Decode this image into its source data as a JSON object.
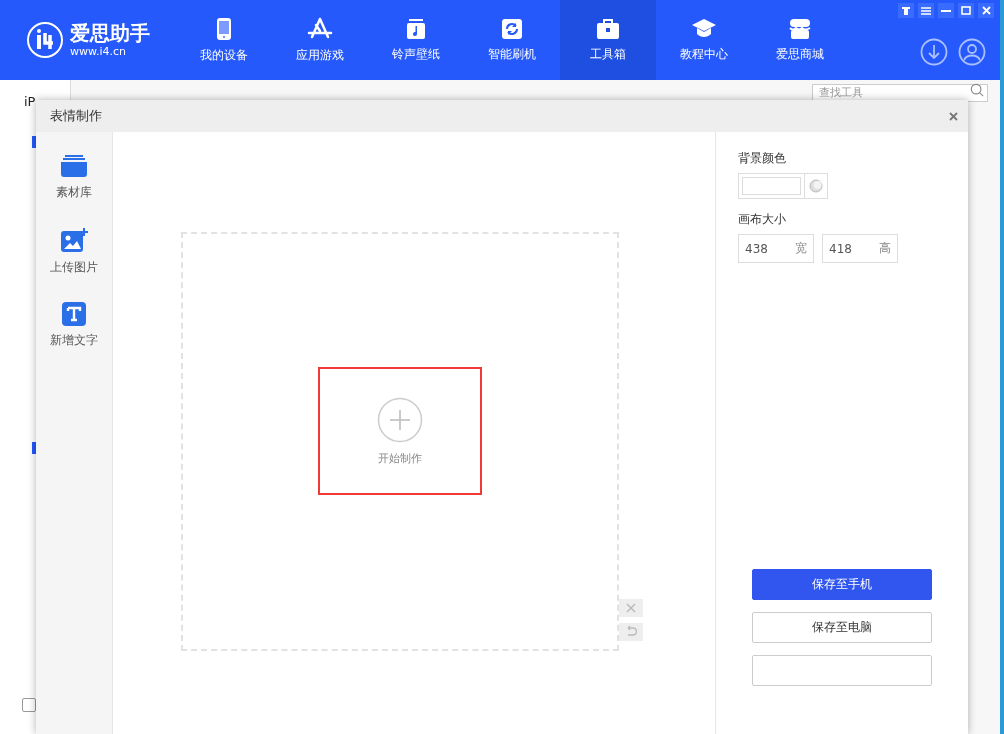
{
  "app": {
    "logo": {
      "name": "爱思助手",
      "url": "www.i4.cn"
    },
    "nav": [
      {
        "label": "我的设备",
        "kind": "phone",
        "selected": false
      },
      {
        "label": "应用游戏",
        "kind": "apps",
        "selected": false
      },
      {
        "label": "铃声壁纸",
        "kind": "music",
        "selected": false
      },
      {
        "label": "智能刷机",
        "kind": "refresh",
        "selected": false
      },
      {
        "label": "工具箱",
        "kind": "toolbox",
        "selected": true
      },
      {
        "label": "教程中心",
        "kind": "graduation",
        "selected": false
      },
      {
        "label": "爱思商城",
        "kind": "store",
        "selected": false
      }
    ],
    "device_tab": "iP",
    "search": {
      "placeholder": "查找工具"
    },
    "footer_checkbox": {
      "checked": false
    }
  },
  "dialog": {
    "title": "表情制作",
    "tools": [
      {
        "label": "素材库",
        "kind": "library"
      },
      {
        "label": "上传图片",
        "kind": "upload"
      },
      {
        "label": "新增文字",
        "kind": "text"
      }
    ],
    "canvas": {
      "start_label": "开始制作"
    },
    "settings": {
      "background_color_label": "背景颜色",
      "canvas_size_label": "画布大小",
      "width": {
        "value": "438",
        "unit": "宽"
      },
      "height": {
        "value": "418",
        "unit": "高"
      }
    },
    "buttons": [
      {
        "label": "保存至手机",
        "kind": "primary"
      },
      {
        "label": "保存至电脑",
        "kind": "secondary"
      }
    ]
  }
}
